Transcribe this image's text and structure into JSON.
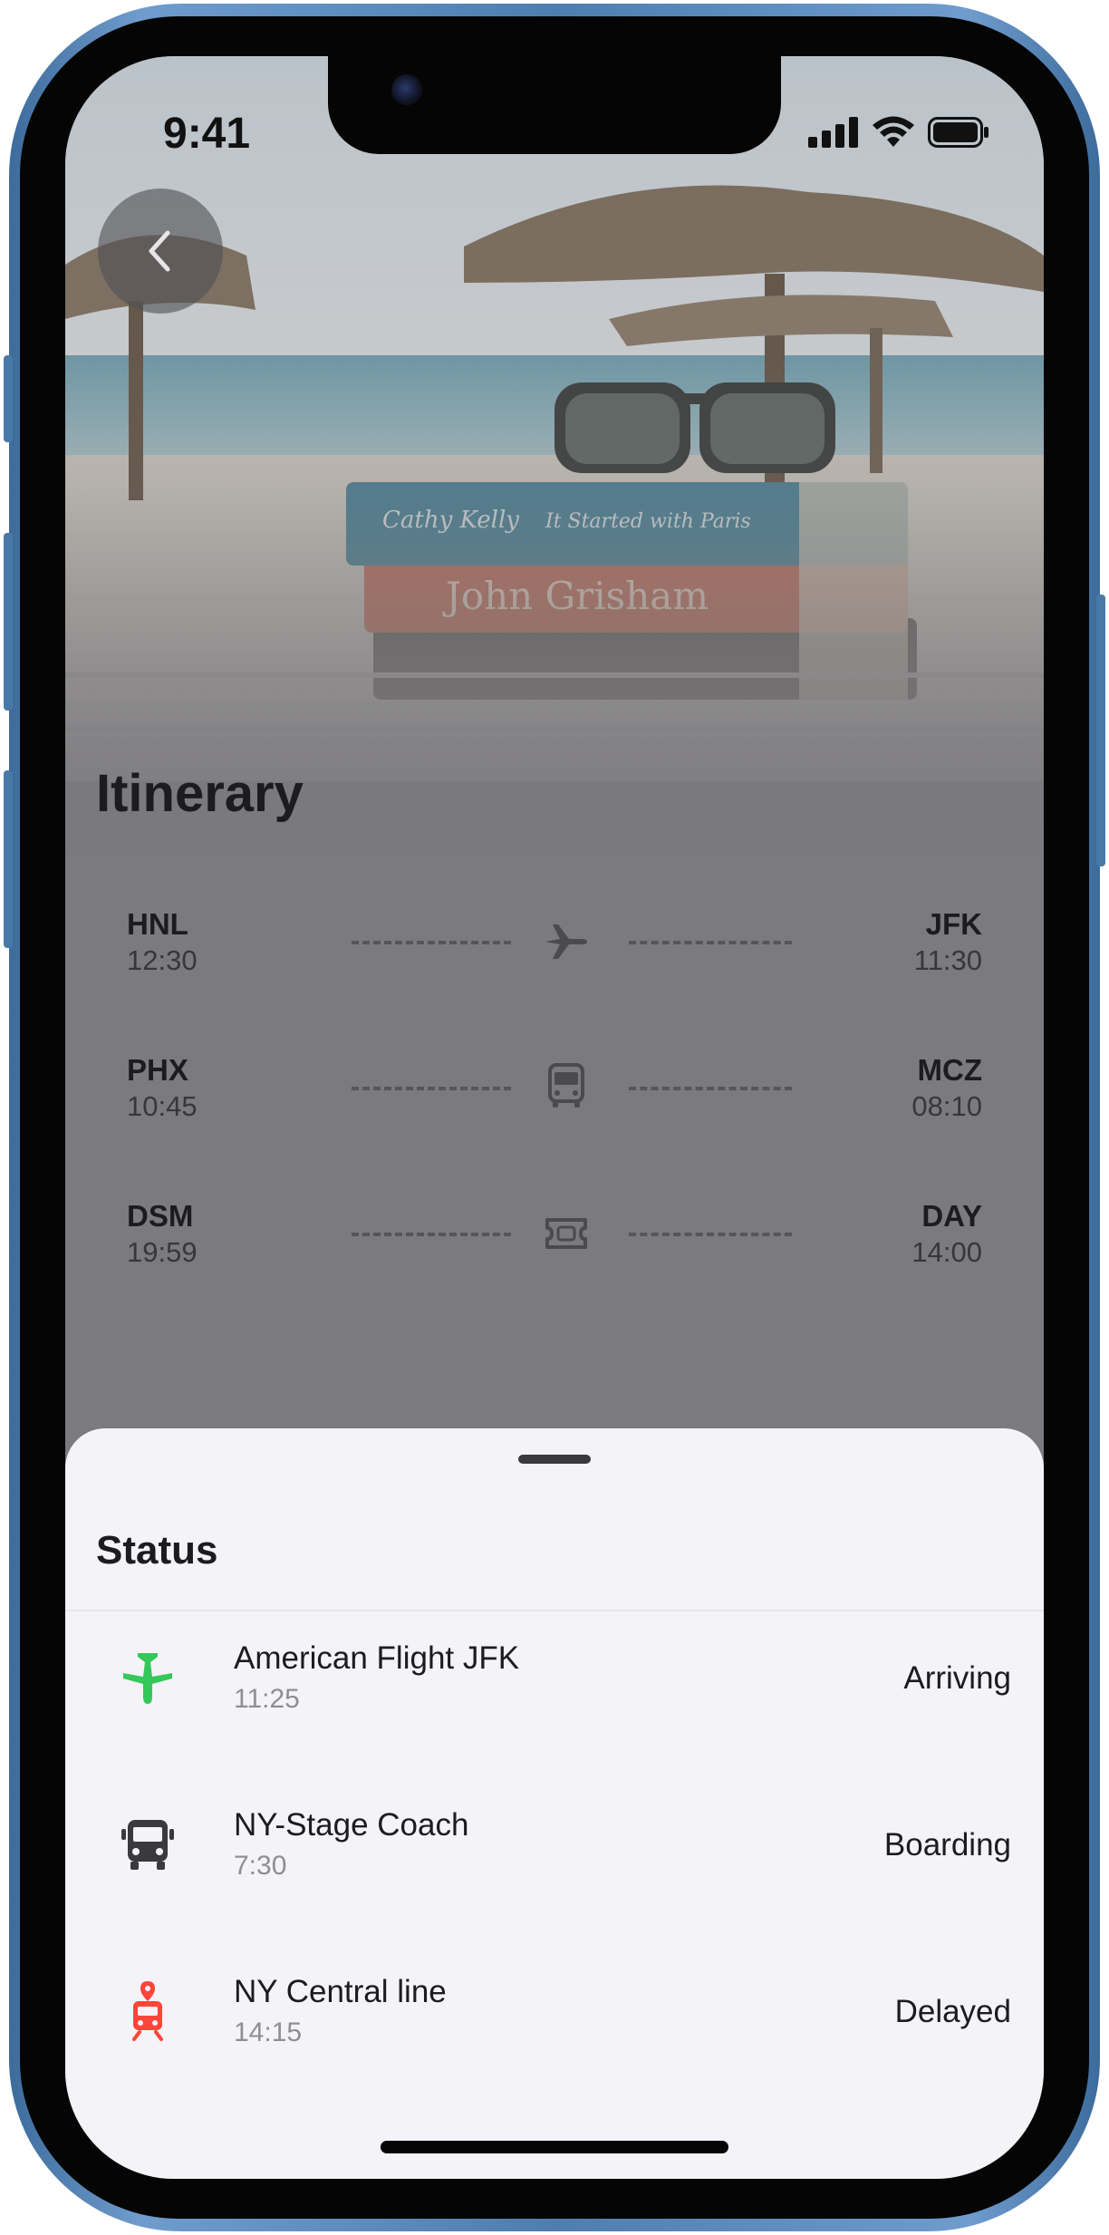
{
  "status_bar": {
    "time": "9:41"
  },
  "page_title": "Itinerary",
  "itinerary": [
    {
      "from_code": "HNL",
      "from_time": "12:30",
      "to_code": "JFK",
      "to_time": "11:30",
      "icon": "airplane-icon"
    },
    {
      "from_code": "PHX",
      "from_time": "10:45",
      "to_code": "MCZ",
      "to_time": "08:10",
      "icon": "bus-icon"
    },
    {
      "from_code": "DSM",
      "from_time": "19:59",
      "to_code": "DAY",
      "to_time": "14:00",
      "icon": "ticket-icon"
    }
  ],
  "sheet": {
    "title": "Status",
    "items": [
      {
        "name": "American Flight JFK",
        "time": "11:25",
        "state": "Arriving",
        "icon": "airplane-icon",
        "color": "#34c759"
      },
      {
        "name": "NY-Stage Coach",
        "time": "7:30",
        "state": "Boarding",
        "icon": "bus-icon",
        "color": "#3a3a3c"
      },
      {
        "name": "NY Central line",
        "time": "14:15",
        "state": "Delayed",
        "icon": "train-icon",
        "color": "#ff453a"
      }
    ]
  },
  "background_photo_text": [
    "Cathy Kelly",
    "It Started with Paris",
    "John Grisham"
  ]
}
